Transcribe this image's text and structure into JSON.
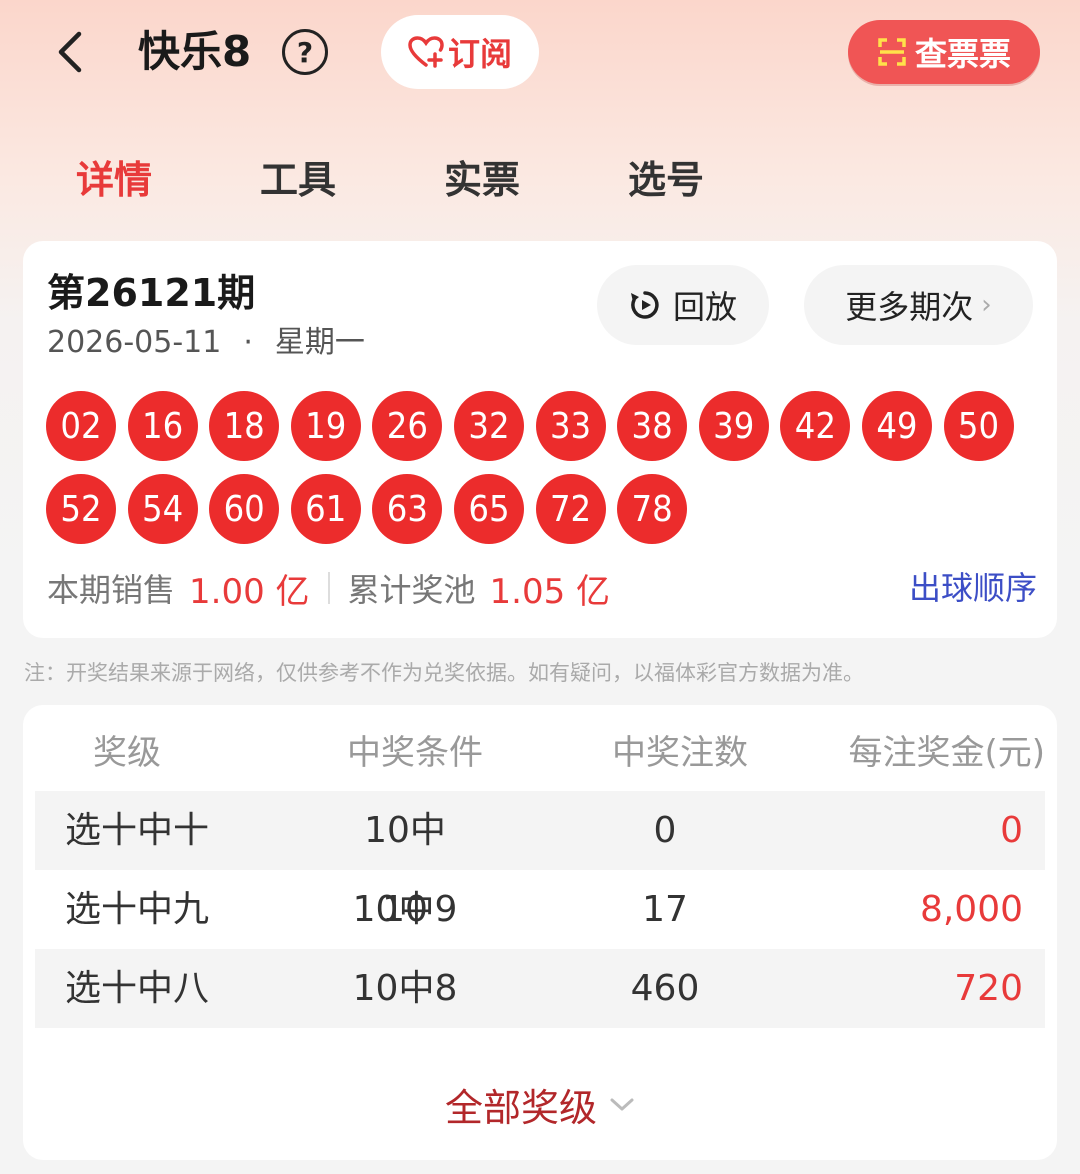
{
  "header": {
    "title": "快乐8",
    "help_glyph": "?",
    "subscribe_label": "订阅",
    "check_ticket_label": "查票票"
  },
  "tabs": [
    {
      "label": "详情",
      "active": true
    },
    {
      "label": "工具",
      "active": false
    },
    {
      "label": "实票",
      "active": false
    },
    {
      "label": "选号",
      "active": false
    }
  ],
  "draw": {
    "issue": "第26121期",
    "date": "2026-05-11",
    "separator": "·",
    "weekday": "星期一",
    "replay_label": "回放",
    "more_label": "更多期次",
    "balls_row1": [
      "02",
      "16",
      "18",
      "19",
      "26",
      "32",
      "33",
      "38",
      "39",
      "42",
      "49",
      "50"
    ],
    "balls_row2": [
      "52",
      "54",
      "60",
      "61",
      "63",
      "65",
      "72",
      "78"
    ],
    "sales_label": "本期销售",
    "sales_value": "1.00 亿",
    "pool_label": "累计奖池",
    "pool_value": "1.05 亿",
    "ball_order_link": "出球顺序"
  },
  "notice": "注：开奖结果来源于网络，仅供参考不作为兑奖依据。如有疑问，以福体彩官方数据为准。",
  "prize_table": {
    "headers": [
      "奖级",
      "中奖条件",
      "中奖注数",
      "每注奖金(元)"
    ],
    "rows": [
      {
        "level": "选十中十",
        "condition": "10中10",
        "count": "0",
        "amount": "0"
      },
      {
        "level": "选十中九",
        "condition": "10中9",
        "count": "17",
        "amount": "8,000"
      },
      {
        "level": "选十中八",
        "condition": "10中8",
        "count": "460",
        "amount": "720"
      }
    ],
    "all_levels_label": "全部奖级"
  },
  "colors": {
    "accent_red": "#e83a3a",
    "ball_red": "#ec2c2c",
    "link_blue": "#3c4ec6",
    "expand_red": "#b2272a"
  }
}
